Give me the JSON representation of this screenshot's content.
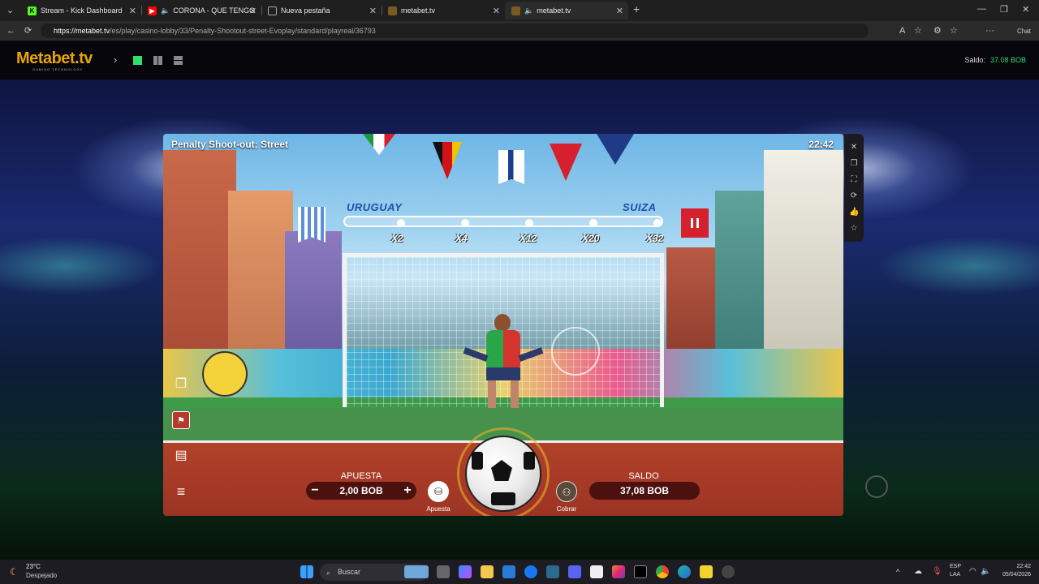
{
  "browser": {
    "tabs": [
      {
        "label": "Stream - Kick Dashboard",
        "icon": "kick-icon"
      },
      {
        "label": "CORONA - QUE TENGO QUE",
        "icon": "youtube-icon"
      },
      {
        "label": "Nueva pestaña",
        "icon": "new-tab-icon"
      },
      {
        "label": "metabet.tv",
        "icon": "metabet-icon"
      },
      {
        "label": "metabet.tv",
        "icon": "metabet-icon"
      }
    ],
    "url_host": "https://metabet.tv",
    "url_path": "/es/play/casino-lobby/33/Penalty-Shootout-street-Evoplay/standard/playreal/36793",
    "chat_label": "Chat"
  },
  "site": {
    "logo": "Metabet.tv",
    "logo_sub": "GAMING TECHNOLOGY",
    "saldo_label": "Saldo:",
    "saldo_value": "37.08 BOB"
  },
  "game": {
    "title": "Penalty Shoot-out: Street",
    "clock": "22:42",
    "team_left": "URUGUAY",
    "team_right": "SUIZA",
    "multipliers": [
      "X2",
      "X4",
      "X12",
      "X20",
      "X32"
    ],
    "apuesta_label": "APUESTA",
    "apuesta_value": "2,00 BOB",
    "minus": "−",
    "plus": "+",
    "apuesta_btn": "Apuesta",
    "saldo_label": "SALDO",
    "saldo_value": "37,08 BOB",
    "cobrar_btn": "Cobrar"
  },
  "taskbar": {
    "temp": "23°C",
    "weather": "Despejado",
    "search": "Buscar",
    "lang1": "ESP",
    "lang2": "LAA",
    "time": "22:42",
    "date": "05/04/2026"
  },
  "colors": {
    "accent_green": "#2ee06b",
    "logo_gold": "#e8a400"
  }
}
